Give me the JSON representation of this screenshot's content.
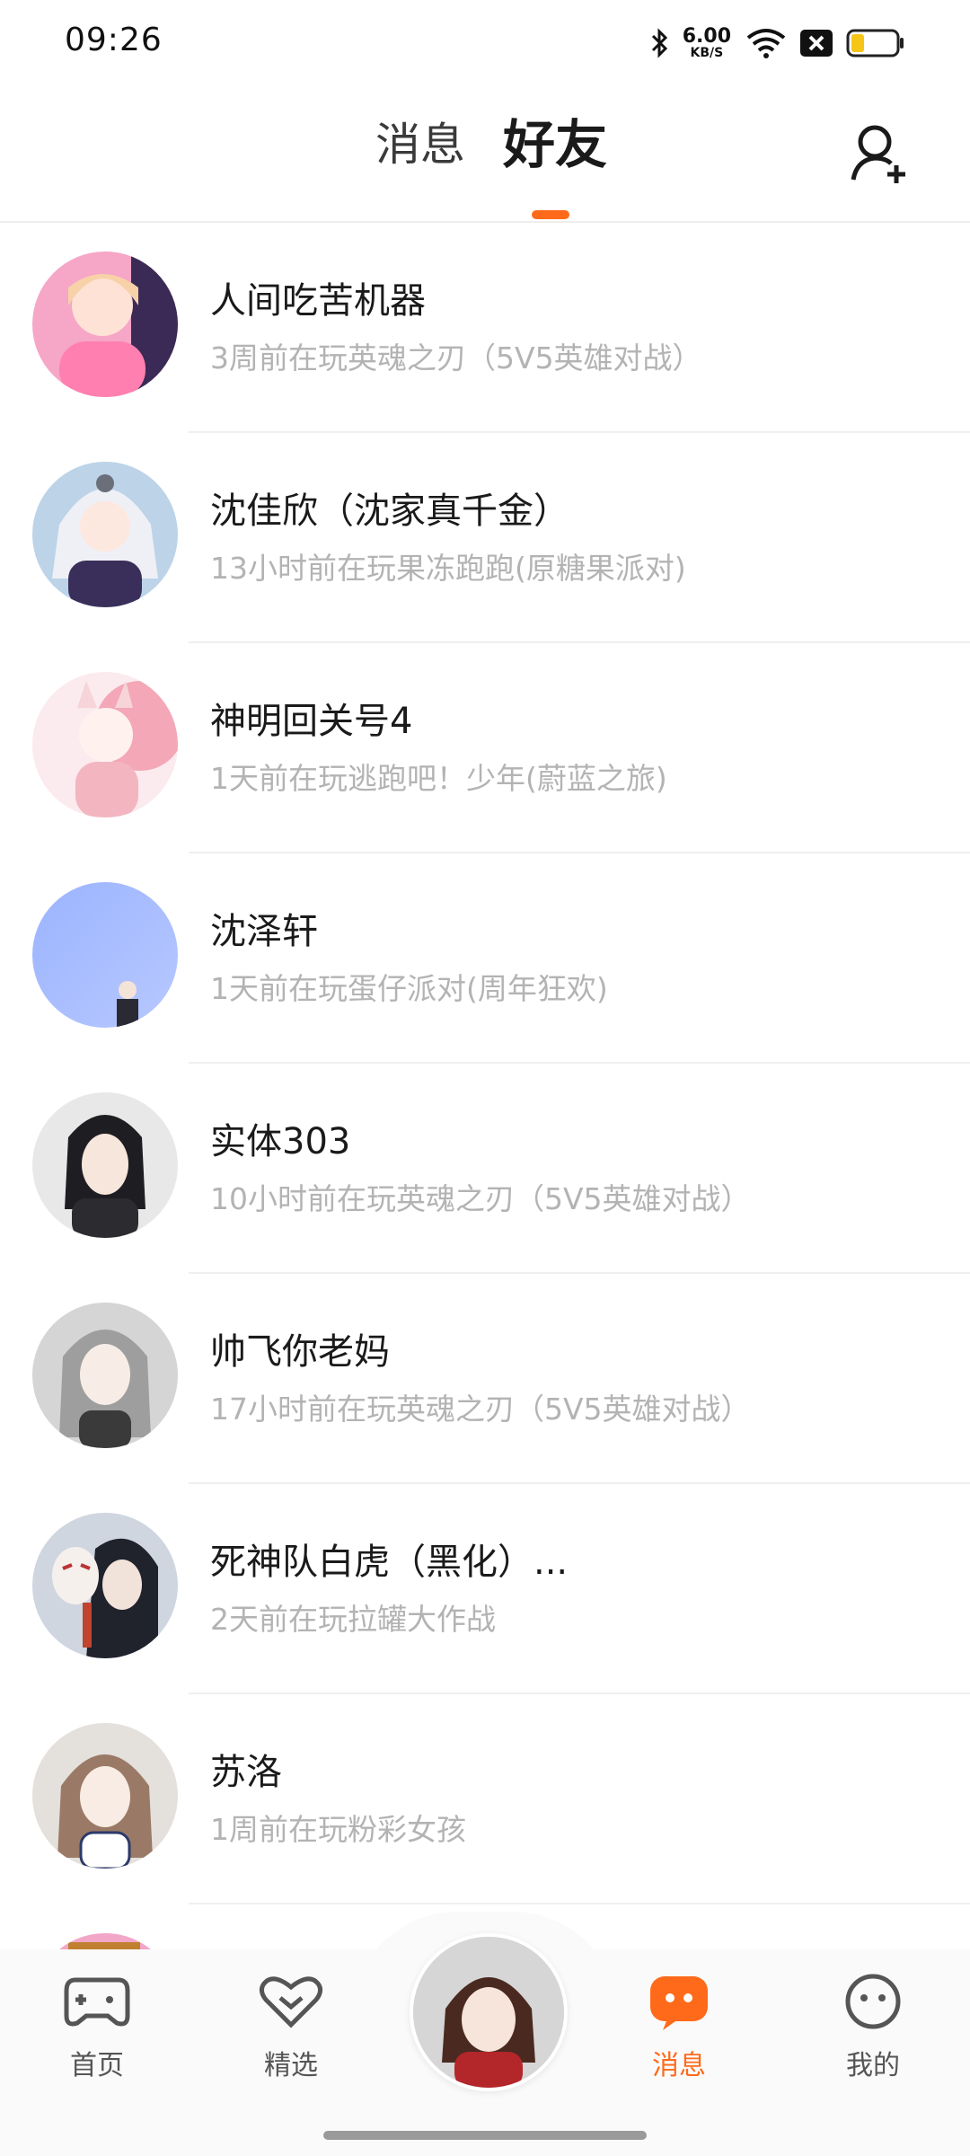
{
  "status_bar": {
    "time": "09:26",
    "net_speed_value": "6.00",
    "net_speed_unit": "KB/S",
    "icons": [
      "bluetooth-icon",
      "wifi-icon",
      "close-box-icon",
      "battery-icon"
    ]
  },
  "header": {
    "tabs": [
      {
        "label": "消息",
        "active": false
      },
      {
        "label": "好友",
        "active": true
      }
    ],
    "accent_color": "#ff6a1a",
    "add_friend_icon": "add-person-icon"
  },
  "friends": [
    {
      "name": "人间吃苦机器",
      "status": "3周前在玩英魂之刃（5V5英雄对战）"
    },
    {
      "name": "沈佳欣（沈家真千金）",
      "status": "13小时前在玩果冻跑跑(原糖果派对)"
    },
    {
      "name": "神明回关号4",
      "status": "1天前在玩逃跑吧！少年(蔚蓝之旅)"
    },
    {
      "name": "沈泽轩",
      "status": "1天前在玩蛋仔派对(周年狂欢)"
    },
    {
      "name": "实体303",
      "status": "10小时前在玩英魂之刃（5V5英雄对战）"
    },
    {
      "name": "帅飞你老妈",
      "status": "17小时前在玩英魂之刃（5V5英雄对战）"
    },
    {
      "name": "死神队白虎（黑化）...",
      "status": "2天前在玩拉罐大作战"
    },
    {
      "name": "苏洛",
      "status": "1周前在玩粉彩女孩"
    }
  ],
  "bottom_nav": {
    "items": [
      {
        "label": "首页",
        "icon": "gamepad-icon",
        "active": false
      },
      {
        "label": "精选",
        "icon": "heart-icon",
        "active": false
      },
      {
        "label": "消息",
        "icon": "chat-bubble-icon",
        "active": true
      },
      {
        "label": "我的",
        "icon": "face-icon",
        "active": false
      }
    ]
  }
}
